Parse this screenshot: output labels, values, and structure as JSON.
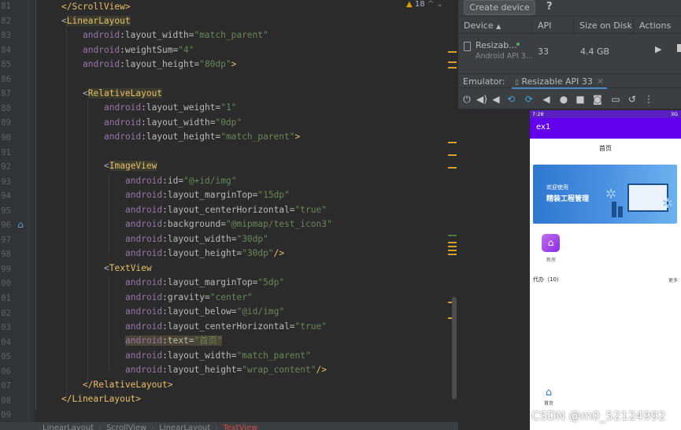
{
  "editor": {
    "line_numbers": [
      "81",
      "82",
      "83",
      "84",
      "85",
      "86",
      "87",
      "88",
      "89",
      "90",
      "91",
      "92",
      "93",
      "94",
      "95",
      "96",
      "97",
      "98",
      "99",
      "00",
      "01",
      "02",
      "03",
      "04",
      "05",
      "06",
      "07",
      "08",
      "09"
    ],
    "warning_count": "18",
    "lines": {
      "l81": {
        "tag": "</ScrollView>"
      },
      "l82": {
        "open": "<",
        "tag": "LinearLayout"
      },
      "l83": {
        "ns": "android",
        "attr": ":layout_width=",
        "val": "\"match_parent\""
      },
      "l84": {
        "ns": "android",
        "attr": ":weightSum=",
        "val": "\"4\""
      },
      "l85": {
        "ns": "android",
        "attr": ":layout_height=",
        "val": "\"80dp\"",
        "end": ">"
      },
      "l87": {
        "open": "<",
        "tag": "RelativeLayout"
      },
      "l88": {
        "ns": "android",
        "attr": ":layout_weight=",
        "val": "\"1\""
      },
      "l89": {
        "ns": "android",
        "attr": ":layout_width=",
        "val": "\"0dp\""
      },
      "l90": {
        "ns": "android",
        "attr": ":layout_height=",
        "val": "\"match_parent\"",
        "end": ">"
      },
      "l92": {
        "open": "<",
        "tag": "ImageView"
      },
      "l93": {
        "ns": "android",
        "attr": ":id=",
        "val": "\"@+id/img\""
      },
      "l94": {
        "ns": "android",
        "attr": ":layout_marginTop=",
        "val": "\"15dp\""
      },
      "l95": {
        "ns": "android",
        "attr": ":layout_centerHorizontal=",
        "val": "\"true\""
      },
      "l96": {
        "ns": "android",
        "attr": ":background=",
        "val": "\"@mipmap/test_icon3\""
      },
      "l97": {
        "ns": "android",
        "attr": ":layout_width=",
        "val": "\"30dp\""
      },
      "l98": {
        "ns": "android",
        "attr": ":layout_height=",
        "val": "\"30dp\"",
        "end": "/>"
      },
      "l99": {
        "open": "<",
        "tag": "TextView"
      },
      "l100": {
        "ns": "android",
        "attr": ":layout_marginTop=",
        "val": "\"5dp\""
      },
      "l101": {
        "ns": "android",
        "attr": ":gravity=",
        "val": "\"center\""
      },
      "l102": {
        "ns": "android",
        "attr": ":layout_below=",
        "val": "\"@id/img\""
      },
      "l103": {
        "ns": "android",
        "attr": ":layout_centerHorizontal=",
        "val": "\"true\""
      },
      "l104": {
        "ns": "android",
        "attr": ":text=",
        "val": "\"首页\""
      },
      "l105": {
        "ns": "android",
        "attr": ":layout_width=",
        "val": "\"match_parent\""
      },
      "l106": {
        "ns": "android",
        "attr": ":layout_height=",
        "val": "\"wrap_content\"",
        "end": "/>"
      },
      "l107": {
        "tag": "</RelativeLayout>"
      },
      "l108": {
        "tag": "</LinearLayout>"
      }
    },
    "breadcrumb": [
      "LinearLayout",
      "ScrollView",
      "LinearLayout",
      "TextView"
    ]
  },
  "device_manager": {
    "create_device_label": "Create device",
    "help_label": "?",
    "columns": [
      "Device",
      "API",
      "Size on Disk",
      "Actions"
    ],
    "device": {
      "name": "Resizab...",
      "subtitle": "Android API 3...",
      "api": "33",
      "size": "4.4 GB"
    },
    "emulator_label": "Emulator:",
    "emulator_tab": "Resizable API 33"
  },
  "phone": {
    "status_time": "7:28",
    "status_right": "3G",
    "app_title": "ex1",
    "page_title": "首页",
    "banner_line1": "欢迎使用",
    "banner_line2": "精装工程管理",
    "icon_label": "新房",
    "todo_title": "代办（10）",
    "todo_more": "更多",
    "bottom_nav_label": "首页"
  },
  "watermark": "CSDN @m0_52124992",
  "colors": {
    "editor_bg": "#2b2b2b",
    "tag": "#e8bf6a",
    "string": "#6a8759",
    "namespace": "#9876aa",
    "app_bar": "#6200ee"
  }
}
